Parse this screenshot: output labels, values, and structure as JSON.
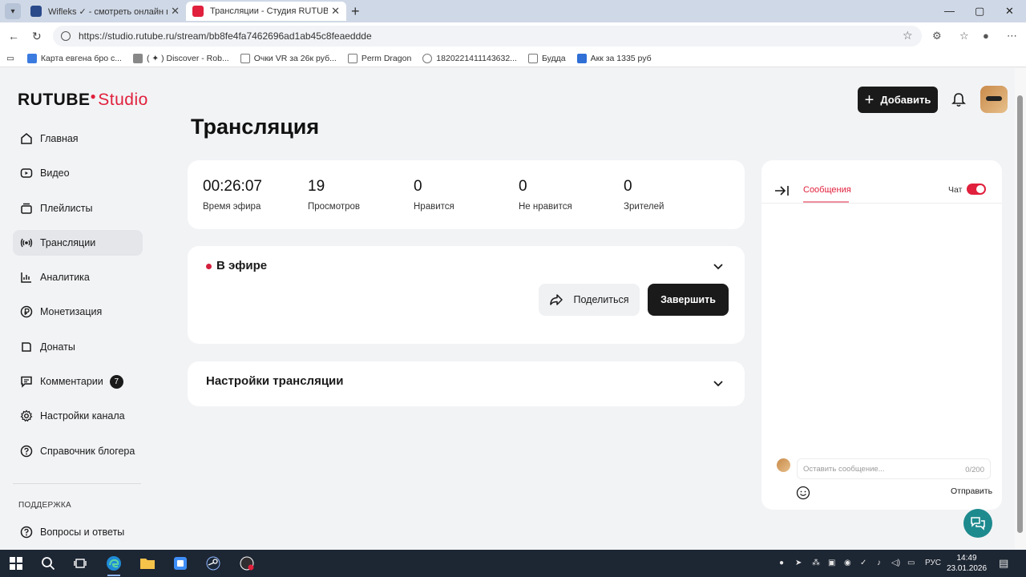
{
  "browser": {
    "tabs": [
      {
        "title": "Wifleks ✓ - смотреть онлайн все",
        "active": false
      },
      {
        "title": "Трансляции - Студия RUTUBE",
        "active": true
      }
    ],
    "url": "https://studio.rutube.ru/stream/bb8fe4fa7462696ad1ab45c8feaeddde",
    "bookmarks": [
      {
        "label": "Карта евгена бро с..."
      },
      {
        "label": "( ✦ ) Discover - Rob..."
      },
      {
        "label": "Очки VR за 26к руб..."
      },
      {
        "label": "Perm Dragon"
      },
      {
        "label": "1820221411143632..."
      },
      {
        "label": "Будда"
      },
      {
        "label": "Акк за 1335 руб"
      }
    ]
  },
  "header": {
    "logo_main": "RUTUBE",
    "logo_studio": "Studio",
    "add_label": "Добавить"
  },
  "sidebar": {
    "items": [
      {
        "label": "Главная",
        "icon": "home-icon"
      },
      {
        "label": "Видео",
        "icon": "video-icon"
      },
      {
        "label": "Плейлисты",
        "icon": "playlist-icon"
      },
      {
        "label": "Трансляции",
        "icon": "broadcast-icon",
        "active": true
      },
      {
        "label": "Аналитика",
        "icon": "analytics-icon"
      },
      {
        "label": "Монетизация",
        "icon": "ruble-icon"
      },
      {
        "label": "Донаты",
        "icon": "donate-icon"
      },
      {
        "label": "Комментарии",
        "icon": "comment-icon",
        "badge": "7"
      },
      {
        "label": "Настройки канала",
        "icon": "gear-icon"
      },
      {
        "label": "Справочник блогера",
        "icon": "help-circle-icon"
      }
    ],
    "support_label": "ПОДДЕРЖКА",
    "faq_label": "Вопросы и ответы"
  },
  "main": {
    "title": "Трансляция",
    "stats": [
      {
        "value": "00:26:07",
        "label": "Время эфира"
      },
      {
        "value": "19",
        "label": "Просмотров"
      },
      {
        "value": "0",
        "label": "Нравится"
      },
      {
        "value": "0",
        "label": "Не нравится"
      },
      {
        "value": "0",
        "label": "Зрителей"
      }
    ],
    "live": {
      "status": "В эфире",
      "share_label": "Поделиться",
      "end_label": "Завершить"
    },
    "settings_title": "Настройки трансляции"
  },
  "chat": {
    "tab_messages": "Сообщения",
    "chat_label": "Чат",
    "chat_enabled": true,
    "input_placeholder": "Оставить сообщение...",
    "counter": "0/200",
    "send_label": "Отправить"
  },
  "taskbar": {
    "lang": "РУС",
    "time": "14:49",
    "date": "23.01.2026"
  },
  "colors": {
    "accent": "#e0203c",
    "dark": "#1a1a1a",
    "help_fab": "#1d8a8e"
  }
}
